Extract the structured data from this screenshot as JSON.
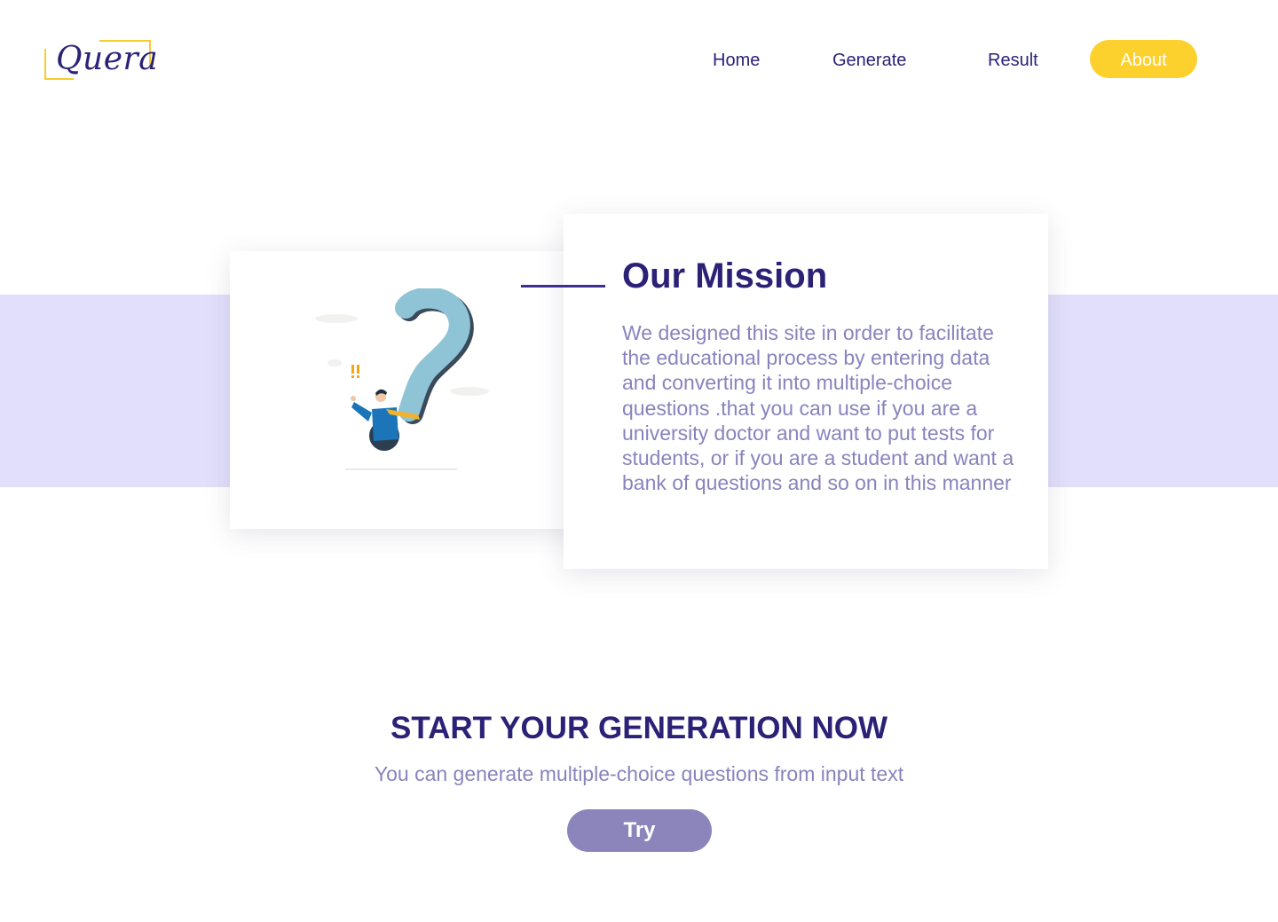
{
  "brand": {
    "logo_text": "Quera"
  },
  "nav": {
    "items": [
      {
        "label": "Home"
      },
      {
        "label": "Generate"
      },
      {
        "label": "Result"
      }
    ],
    "active_button": "About"
  },
  "mission": {
    "title": "Our Mission",
    "body": "We designed this site in order to facilitate the educational process by entering data and converting it into multiple-choice questions .that you can use if you are a university doctor and want to put tests for students, or if you are a student and want a bank of questions and so on in this manner",
    "illustration_icon": "question-mark-person-illustration"
  },
  "cta": {
    "title": "START YOUR GENERATION NOW",
    "subtitle": "You can generate multiple-choice questions from input text",
    "button_label": "Try"
  },
  "colors": {
    "primary": "#2b2277",
    "accent": "#fcd12d",
    "muted_text": "#8983bd",
    "band": "#e2dffc",
    "button": "#8c85bb"
  }
}
